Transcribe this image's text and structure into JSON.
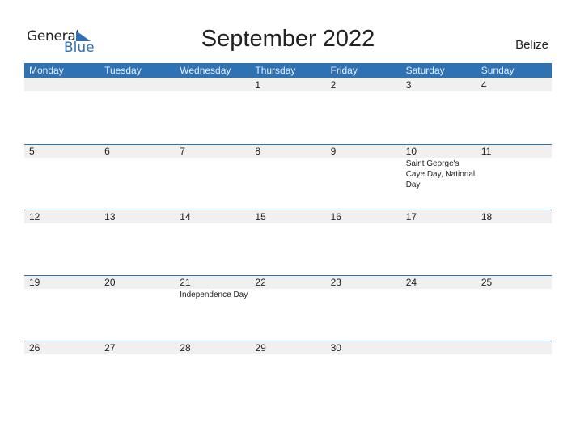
{
  "logo": {
    "general": "General",
    "blue": "Blue"
  },
  "title": "September 2022",
  "country": "Belize",
  "colors": {
    "accent": "#2e72b4",
    "strip": "#f0f0f0"
  },
  "weekdays": [
    "Monday",
    "Tuesday",
    "Wednesday",
    "Thursday",
    "Friday",
    "Saturday",
    "Sunday"
  ],
  "weeks": [
    {
      "days": [
        "",
        "",
        "",
        "1",
        "2",
        "3",
        "4"
      ],
      "holidays": [
        "",
        "",
        "",
        "",
        "",
        "",
        ""
      ]
    },
    {
      "days": [
        "5",
        "6",
        "7",
        "8",
        "9",
        "10",
        "11"
      ],
      "holidays": [
        "",
        "",
        "",
        "",
        "",
        "Saint George's Caye Day, National Day",
        ""
      ]
    },
    {
      "days": [
        "12",
        "13",
        "14",
        "15",
        "16",
        "17",
        "18"
      ],
      "holidays": [
        "",
        "",
        "",
        "",
        "",
        "",
        ""
      ]
    },
    {
      "days": [
        "19",
        "20",
        "21",
        "22",
        "23",
        "24",
        "25"
      ],
      "holidays": [
        "",
        "",
        "Independence Day",
        "",
        "",
        "",
        ""
      ]
    },
    {
      "days": [
        "26",
        "27",
        "28",
        "29",
        "30",
        "",
        ""
      ],
      "holidays": [
        "",
        "",
        "",
        "",
        "",
        "",
        ""
      ]
    }
  ]
}
